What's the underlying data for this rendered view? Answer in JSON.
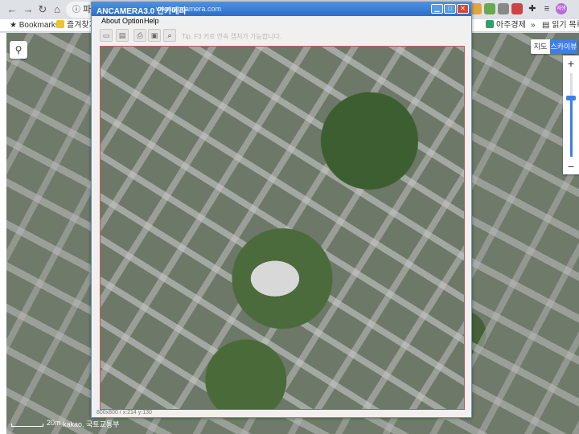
{
  "browser": {
    "address_fragment": "파",
    "bookmarks": [
      {
        "label": "Bookmarks",
        "icon": "star-icon"
      },
      {
        "label": "즐겨찾기",
        "icon": "folder-icon"
      },
      {
        "label": "아주경제",
        "icon": "site-icon"
      },
      {
        "label": "»",
        "icon": ""
      },
      {
        "label": "읽기 목록",
        "icon": "reading-list-icon"
      }
    ],
    "extensions": [
      "translate-icon",
      "notes-icon",
      "screen-icon",
      "ext-icon",
      "puzzle-icon",
      "playlist-icon"
    ],
    "profile_label": "재생"
  },
  "map": {
    "type_tabs": [
      "지도",
      "스카이뷰"
    ],
    "active_type": "스카이뷰",
    "zoom_plus": "+",
    "zoom_minus": "−",
    "zoom_level": 0.7,
    "scale_label": "20m",
    "credit": "kakao, 국토교통부",
    "colors": {
      "accent": "#3d7ee8"
    }
  },
  "app": {
    "title": "ANCAMERA3.0 안카메라",
    "url": "www.ancamera.com",
    "menu": [
      "About",
      "Option",
      "Help"
    ],
    "tools": [
      "capture-icon",
      "window-icon",
      "print-icon",
      "save-icon",
      "zoom-icon"
    ],
    "tip": "Tip. F3 키로 연속 캡처가 가능합니다.",
    "status": "800x800 / x:214 y:130",
    "controls": {
      "minimize": "▁",
      "maximize": "□",
      "close": "✕"
    }
  }
}
